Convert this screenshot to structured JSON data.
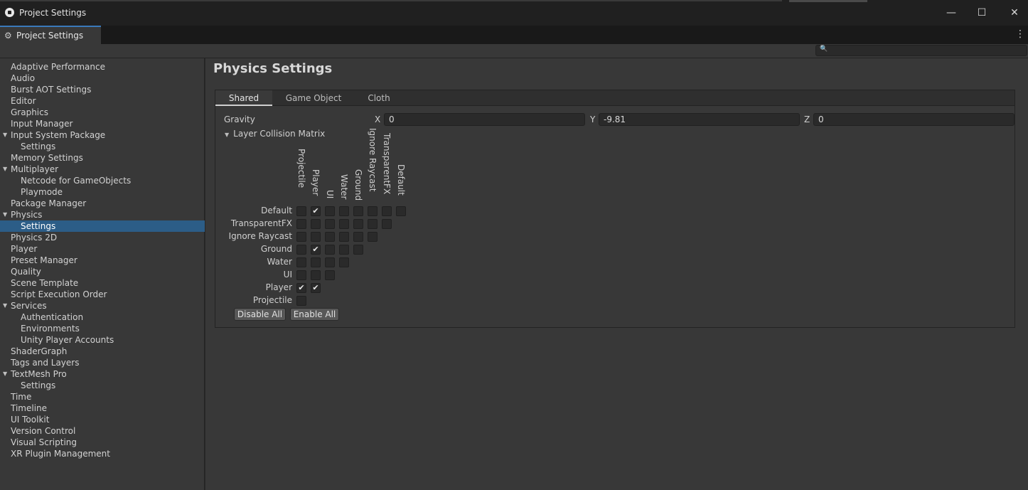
{
  "window": {
    "title": "Project Settings",
    "minimize": "—",
    "maximize": "☐",
    "close": "✕"
  },
  "tab": {
    "label": "Project Settings",
    "icon": "gear-icon"
  },
  "search": {
    "placeholder": ""
  },
  "sidebar": {
    "items": [
      {
        "label": "Adaptive Performance",
        "level": 0
      },
      {
        "label": "Audio",
        "level": 0
      },
      {
        "label": "Burst AOT Settings",
        "level": 0
      },
      {
        "label": "Editor",
        "level": 0
      },
      {
        "label": "Graphics",
        "level": 0
      },
      {
        "label": "Input Manager",
        "level": 0
      },
      {
        "label": "Input System Package",
        "level": 0,
        "expanded": true
      },
      {
        "label": "Settings",
        "level": 1
      },
      {
        "label": "Memory Settings",
        "level": 0
      },
      {
        "label": "Multiplayer",
        "level": 0,
        "expanded": true
      },
      {
        "label": "Netcode for GameObjects",
        "level": 1
      },
      {
        "label": "Playmode",
        "level": 1
      },
      {
        "label": "Package Manager",
        "level": 0
      },
      {
        "label": "Physics",
        "level": 0,
        "expanded": true
      },
      {
        "label": "Settings",
        "level": 1,
        "selected": true
      },
      {
        "label": "Physics 2D",
        "level": 0
      },
      {
        "label": "Player",
        "level": 0
      },
      {
        "label": "Preset Manager",
        "level": 0
      },
      {
        "label": "Quality",
        "level": 0
      },
      {
        "label": "Scene Template",
        "level": 0
      },
      {
        "label": "Script Execution Order",
        "level": 0
      },
      {
        "label": "Services",
        "level": 0,
        "expanded": true
      },
      {
        "label": "Authentication",
        "level": 1
      },
      {
        "label": "Environments",
        "level": 1
      },
      {
        "label": "Unity Player Accounts",
        "level": 1
      },
      {
        "label": "ShaderGraph",
        "level": 0
      },
      {
        "label": "Tags and Layers",
        "level": 0
      },
      {
        "label": "TextMesh Pro",
        "level": 0,
        "expanded": true
      },
      {
        "label": "Settings",
        "level": 1
      },
      {
        "label": "Time",
        "level": 0
      },
      {
        "label": "Timeline",
        "level": 0
      },
      {
        "label": "UI Toolkit",
        "level": 0
      },
      {
        "label": "Version Control",
        "level": 0
      },
      {
        "label": "Visual Scripting",
        "level": 0
      },
      {
        "label": "XR Plugin Management",
        "level": 0
      }
    ]
  },
  "main": {
    "title": "Physics Settings",
    "tabs": [
      {
        "label": "Shared",
        "active": true
      },
      {
        "label": "Game Object",
        "active": false
      },
      {
        "label": "Cloth",
        "active": false
      }
    ],
    "gravity": {
      "label": "Gravity",
      "x_label": "X",
      "x": "0",
      "y_label": "Y",
      "y": "-9.81",
      "z_label": "Z",
      "z": "0"
    },
    "matrix": {
      "title": "Layer Collision Matrix",
      "columns": [
        "Projectile",
        "Player",
        "UI",
        "Water",
        "Ground",
        "Ignore Raycast",
        "TransparentFX",
        "Default"
      ],
      "rows": [
        {
          "name": "Default",
          "checks": [
            false,
            true,
            false,
            false,
            false,
            false,
            false,
            false
          ]
        },
        {
          "name": "TransparentFX",
          "checks": [
            false,
            false,
            false,
            false,
            false,
            false,
            false
          ]
        },
        {
          "name": "Ignore Raycast",
          "checks": [
            false,
            false,
            false,
            false,
            false,
            false
          ]
        },
        {
          "name": "Ground",
          "checks": [
            false,
            true,
            false,
            false,
            false
          ]
        },
        {
          "name": "Water",
          "checks": [
            false,
            false,
            false,
            false
          ]
        },
        {
          "name": "UI",
          "checks": [
            false,
            false,
            false
          ]
        },
        {
          "name": "Player",
          "checks": [
            true,
            true
          ]
        },
        {
          "name": "Projectile",
          "checks": [
            false
          ]
        }
      ],
      "disable_all": "Disable All",
      "enable_all": "Enable All"
    }
  }
}
